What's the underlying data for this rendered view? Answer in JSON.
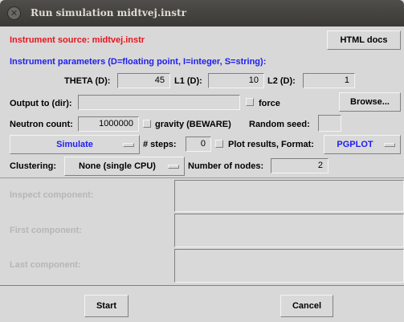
{
  "window": {
    "title": "Run simulation midtvej.instr",
    "close_glyph": "✕"
  },
  "source": {
    "text": "Instrument source: midtvej.instr",
    "html_docs_label": "HTML docs"
  },
  "params": {
    "header": "Instrument parameters (D=floating point, I=integer, S=string):",
    "theta_label": "THETA (D):",
    "theta_value": "45",
    "l1_label": "L1 (D):",
    "l1_value": "10",
    "l2_label": "L2 (D):",
    "l2_value": "1"
  },
  "output": {
    "label": "Output to (dir):",
    "value": "",
    "force_label": "force",
    "browse_label": "Browse..."
  },
  "neutron": {
    "count_label": "Neutron count:",
    "count_value": "1000000",
    "gravity_label": "gravity (BEWARE)",
    "seed_label": "Random seed:",
    "seed_value": ""
  },
  "mode": {
    "simulate_label": "Simulate",
    "steps_label": "# steps:",
    "steps_value": "0",
    "plot_label": "Plot results, Format:",
    "format_value": "PGPLOT"
  },
  "cluster": {
    "label": "Clustering:",
    "value": "None (single CPU)",
    "nodes_label": "Number of nodes:",
    "nodes_value": "2"
  },
  "components": {
    "inspect_label": "Inspect component:",
    "first_label": "First component:",
    "last_label": "Last component:"
  },
  "actions": {
    "start_label": "Start",
    "cancel_label": "Cancel"
  },
  "colors": {
    "accent_blue": "#1e1ef0",
    "source_red": "#e8141e",
    "disabled_grey": "#b6b6b6",
    "background": "#d8d8d8"
  }
}
